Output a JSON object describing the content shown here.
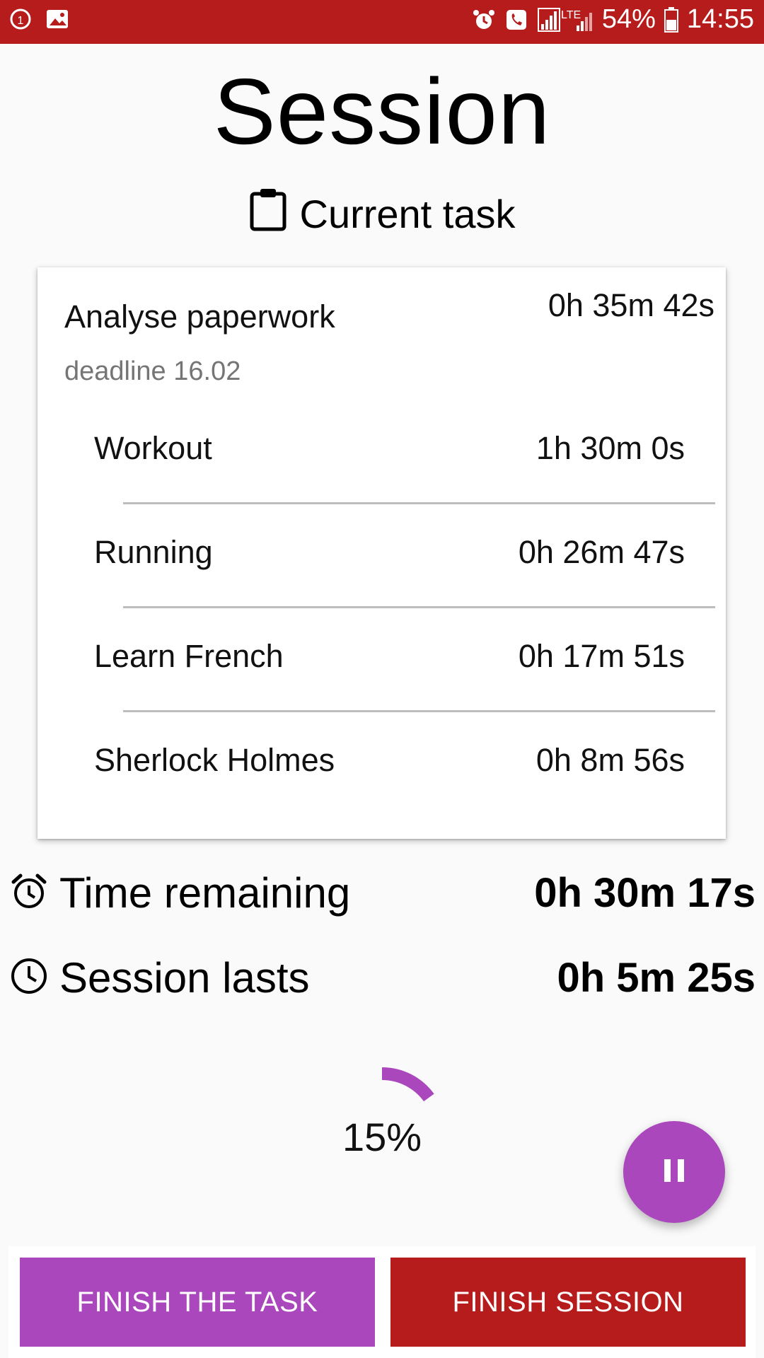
{
  "status_bar": {
    "battery_text": "54%",
    "time": "14:55",
    "network": "LTE"
  },
  "page": {
    "title": "Session",
    "current_task_label": "Current task"
  },
  "current_task": {
    "name": "Analyse paperwork",
    "time": "0h 35m 42s",
    "deadline": "deadline 16.02",
    "subtasks": [
      {
        "name": "Workout",
        "time": "1h 30m 0s"
      },
      {
        "name": "Running",
        "time": "0h 26m 47s"
      },
      {
        "name": "Learn French",
        "time": "0h 17m 51s"
      },
      {
        "name": "Sherlock Holmes",
        "time": "0h 8m 56s"
      }
    ]
  },
  "stats": {
    "remaining_label": "Time remaining",
    "remaining_value": "0h 30m 17s",
    "lasts_label": "Session lasts",
    "lasts_value": "0h 5m 25s"
  },
  "progress": {
    "percent_text": "15%",
    "value": 0.15
  },
  "buttons": {
    "finish_task": "FINISH THE TASK",
    "finish_session": "FINISH SESSION"
  },
  "icons": {
    "status_left": [
      "rotate-icon",
      "image-icon"
    ],
    "status_right": [
      "alarm-icon",
      "phone-icon",
      "signal-icon",
      "battery-icon"
    ],
    "current_task": "clipboard-icon",
    "remaining": "alarm-clock-icon",
    "lasts": "clock-icon",
    "fab": "pause-icon"
  },
  "colors": {
    "status_bar": "#b71c1c",
    "accent_purple": "#ab47bc",
    "accent_red": "#b71c1c"
  }
}
